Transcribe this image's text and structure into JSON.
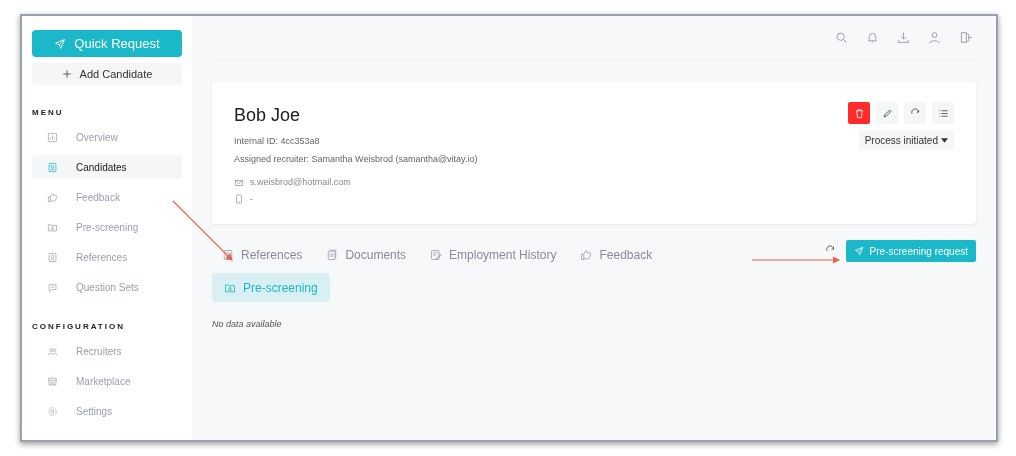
{
  "sidebar": {
    "primary_button": "Quick Request",
    "secondary_button": "Add Candidate",
    "sections": [
      {
        "heading": "MENU",
        "items": [
          {
            "label": "Overview",
            "selected": false
          },
          {
            "label": "Candidates",
            "selected": true
          },
          {
            "label": "Feedback",
            "selected": false
          },
          {
            "label": "Pre-screening",
            "selected": false
          },
          {
            "label": "References",
            "selected": false
          },
          {
            "label": "Question Sets",
            "selected": false
          }
        ]
      },
      {
        "heading": "CONFIGURATION",
        "items": [
          {
            "label": "Recruiters",
            "selected": false
          },
          {
            "label": "Marketplace",
            "selected": false
          },
          {
            "label": "Settings",
            "selected": false
          }
        ]
      }
    ]
  },
  "candidate": {
    "name": "Bob Joe",
    "internal_id": "Internal ID: 4cc353a8",
    "recruiter": "Assigned recruiter: Samantha Weisbrod (samantha@vitay.io)",
    "email": "s.weisbrod@hotmail.com",
    "phone": "-",
    "status": "Process initiated"
  },
  "tabs": [
    {
      "label": "References",
      "selected": false
    },
    {
      "label": "Documents",
      "selected": false
    },
    {
      "label": "Employment History",
      "selected": false
    },
    {
      "label": "Feedback",
      "selected": false
    },
    {
      "label": "Pre-screening",
      "selected": true
    }
  ],
  "action_button": "Pre-screening request",
  "empty_message": "No data available"
}
